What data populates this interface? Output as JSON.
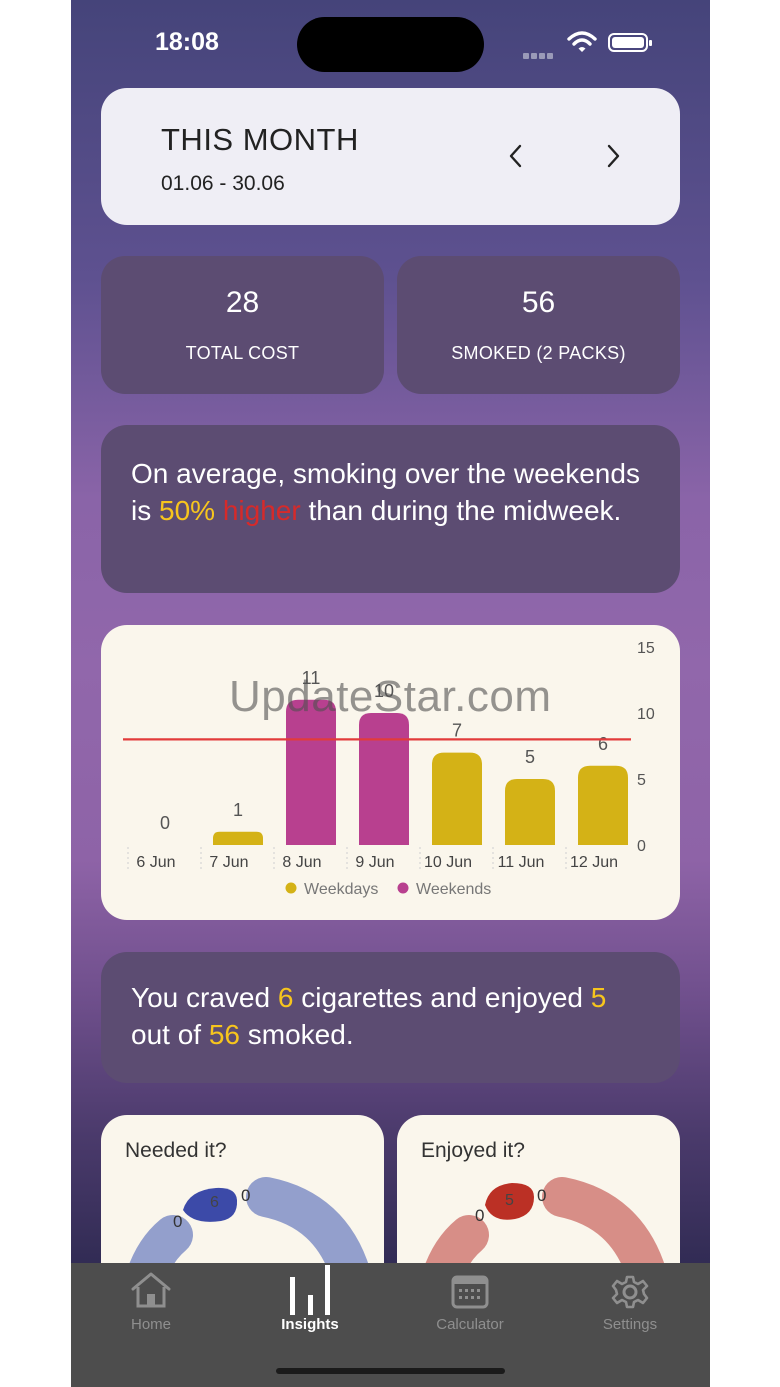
{
  "status": {
    "time": "18:08"
  },
  "period": {
    "title": "THIS MONTH",
    "range": "01.06 - 30.06"
  },
  "stats": [
    {
      "value": "28",
      "label": "TOTAL COST"
    },
    {
      "value": "56",
      "label": "SMOKED (2 PACKS)"
    }
  ],
  "insight": {
    "part1": "On average, smoking over the weekends is ",
    "percent": "50%",
    "direction": " higher",
    "part2": " than during the midweek."
  },
  "cravings": {
    "p1": "You craved ",
    "craved": "6",
    "p2": " cigarettes and enjoyed ",
    "enjoyed": "5",
    "p3": " out of ",
    "total": "56",
    "p4": " smoked."
  },
  "chart_data": {
    "type": "bar",
    "categories": [
      "6 Jun",
      "7 Jun",
      "8 Jun",
      "9 Jun",
      "10 Jun",
      "11 Jun",
      "12 Jun"
    ],
    "values": [
      0,
      1,
      11,
      10,
      7,
      5,
      6
    ],
    "groups": [
      "Weekdays",
      "Weekdays",
      "Weekends",
      "Weekends",
      "Weekdays",
      "Weekdays",
      "Weekdays"
    ],
    "legend": [
      "Weekdays",
      "Weekends"
    ],
    "colors": {
      "Weekdays": "#d4b216",
      "Weekends": "#b8408f",
      "average_line": "#e23b3b"
    },
    "average_line": 8,
    "ylim": [
      0,
      15
    ],
    "yticks": [
      0,
      5,
      10,
      15
    ],
    "legend_position": "bottom"
  },
  "gauges": [
    {
      "title": "Needed it?",
      "value": "6",
      "left_label": "0",
      "right_label": "0",
      "accent": "#3c4aa8",
      "track": "#939fcc"
    },
    {
      "title": "Enjoyed it?",
      "value": "5",
      "left_label": "0",
      "right_label": "0",
      "accent": "#bb3025",
      "track": "#d78e87"
    }
  ],
  "watermark": "UpdateStar.com",
  "tabs": [
    {
      "label": "Home",
      "icon": "home-icon",
      "active": false
    },
    {
      "label": "Insights",
      "icon": "bar-chart-icon",
      "active": true
    },
    {
      "label": "Calculator",
      "icon": "calculator-icon",
      "active": false
    },
    {
      "label": "Settings",
      "icon": "gear-icon",
      "active": false
    }
  ]
}
